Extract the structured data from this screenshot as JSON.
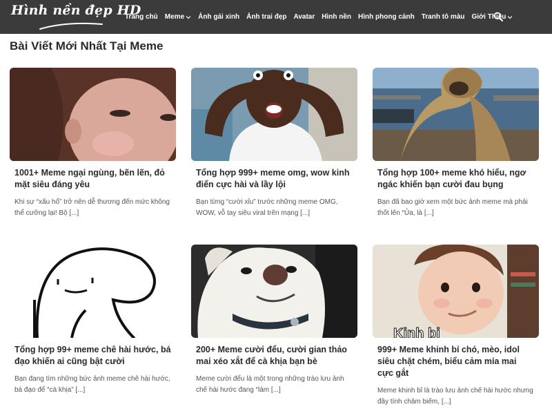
{
  "site": {
    "logo_text": "Hình nền đẹp HD"
  },
  "nav": {
    "items": [
      {
        "label": "Trang chủ"
      },
      {
        "label": "Meme",
        "has_dropdown": true
      },
      {
        "label": "Ảnh gái xinh"
      },
      {
        "label": "Ảnh trai đẹp"
      },
      {
        "label": "Avatar"
      },
      {
        "label": "Hình nền"
      },
      {
        "label": "Hình phong cảnh"
      },
      {
        "label": "Tranh tô màu"
      },
      {
        "label": "Giới Thiệu",
        "has_dropdown": true
      }
    ],
    "search_icon": "search-icon"
  },
  "page": {
    "title": "Bài Viết Mới Nhất Tại Meme"
  },
  "posts": [
    {
      "title": "1001+ Meme ngại ngùng, bẽn lẽn, đỏ mặt siêu đáng yêu",
      "excerpt": "Khi sự “xấu hổ” trở nên dễ thương đến mức không thể cưỡng lại! Bộ [...]"
    },
    {
      "title": "Tổng hợp 999+ meme omg, wow kinh điển cực hài và lầy lội",
      "excerpt": "Bạn từng “cười xỉu” trước những meme OMG, WOW, vỗ tay siêu viral trên mạng [...]"
    },
    {
      "title": "Tổng hợp 100+ meme khó hiểu, ngơ ngác khiến bạn cười đau bụng",
      "excerpt": "Bạn đã bao giờ xem một bức ảnh meme mà phải thốt lên “Ủa, là [...]"
    },
    {
      "title": "Tổng hợp 99+ meme chê hài hước, bá đạo khiến ai cũng bật cười",
      "excerpt": "Bạn đang tìm những bức ảnh meme chê hài hước, bá đạo để “cà khịa” [...]"
    },
    {
      "title": "200+ Meme cười đểu, cười gian thảo mai xéo xắt để cà khịa bạn bè",
      "excerpt": "Meme cười đểu là một trong những trào lưu ảnh chế hài hước đang “làm [...]"
    },
    {
      "title": "999+ Meme khinh bỉ chó, mèo, idol siêu chặt chém, biểu cảm mỉa mai cực gắt",
      "excerpt": "Meme khinh bỉ là trào lưu ảnh chế hài hước nhưng đầy tính châm biếm, [...]",
      "image_text": "Kinh bi"
    }
  ]
}
